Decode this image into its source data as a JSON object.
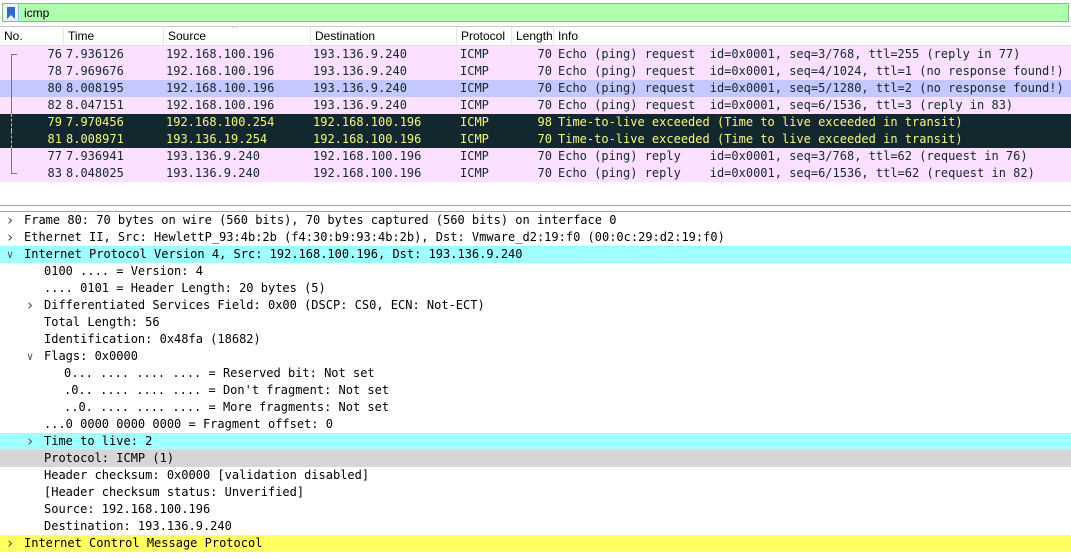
{
  "filter": {
    "text": "icmp"
  },
  "columns": [
    "No.",
    "Time",
    "Source",
    "Destination",
    "Protocol",
    "Length",
    "Info"
  ],
  "packets": [
    {
      "no": "76",
      "time": "7.936126",
      "src": "192.168.100.196",
      "dst": "193.136.9.240",
      "proto": "ICMP",
      "len": "70",
      "info": "Echo (ping) request  id=0x0001, seq=3/768, ttl=255 (reply in 77)",
      "style": "pink",
      "bracket": "first"
    },
    {
      "no": "78",
      "time": "7.969676",
      "src": "192.168.100.196",
      "dst": "193.136.9.240",
      "proto": "ICMP",
      "len": "70",
      "info": "Echo (ping) request  id=0x0001, seq=4/1024, ttl=1 (no response found!)",
      "style": "pink",
      "bracket": "mid"
    },
    {
      "no": "80",
      "time": "8.008195",
      "src": "192.168.100.196",
      "dst": "193.136.9.240",
      "proto": "ICMP",
      "len": "70",
      "info": "Echo (ping) request  id=0x0001, seq=5/1280, ttl=2 (no response found!)",
      "style": "selected",
      "bracket": "mid"
    },
    {
      "no": "82",
      "time": "8.047151",
      "src": "192.168.100.196",
      "dst": "193.136.9.240",
      "proto": "ICMP",
      "len": "70",
      "info": "Echo (ping) request  id=0x0001, seq=6/1536, ttl=3 (reply in 83)",
      "style": "pink",
      "bracket": "mid"
    },
    {
      "no": "79",
      "time": "7.970456",
      "src": "192.168.100.254",
      "dst": "192.168.100.196",
      "proto": "ICMP",
      "len": "98",
      "info": "Time-to-live exceeded (Time to live exceeded in transit)",
      "style": "dark",
      "bracket": "dashed"
    },
    {
      "no": "81",
      "time": "8.008971",
      "src": "193.136.19.254",
      "dst": "192.168.100.196",
      "proto": "ICMP",
      "len": "70",
      "info": "Time-to-live exceeded (Time to live exceeded in transit)",
      "style": "dark",
      "bracket": "dashed"
    },
    {
      "no": "77",
      "time": "7.936941",
      "src": "193.136.9.240",
      "dst": "192.168.100.196",
      "proto": "ICMP",
      "len": "70",
      "info": "Echo (ping) reply    id=0x0001, seq=3/768, ttl=62 (request in 76)",
      "style": "pink",
      "bracket": "mid"
    },
    {
      "no": "83",
      "time": "8.048025",
      "src": "193.136.9.240",
      "dst": "192.168.100.196",
      "proto": "ICMP",
      "len": "70",
      "info": "Echo (ping) reply    id=0x0001, seq=6/1536, ttl=62 (request in 82)",
      "style": "pink",
      "bracket": "last"
    }
  ],
  "details": [
    {
      "text": "Frame 80: 70 bytes on wire (560 bits), 70 bytes captured (560 bits) on interface 0",
      "level": 0,
      "arrow": "collapsed",
      "style": "first"
    },
    {
      "text": "Ethernet II, Src: HewlettP_93:4b:2b (f4:30:b9:93:4b:2b), Dst: Vmware_d2:19:f0 (00:0c:29:d2:19:f0)",
      "level": 0,
      "arrow": "collapsed",
      "style": "top"
    },
    {
      "text": "Internet Protocol Version 4, Src: 192.168.100.196, Dst: 193.136.9.240",
      "level": 0,
      "arrow": "expanded",
      "style": "cyan"
    },
    {
      "text": "0100 .... = Version: 4",
      "level": 1,
      "arrow": "none",
      "style": "top"
    },
    {
      "text": ".... 0101 = Header Length: 20 bytes (5)",
      "level": 1,
      "arrow": "none",
      "style": "top"
    },
    {
      "text": "Differentiated Services Field: 0x00 (DSCP: CS0, ECN: Not-ECT)",
      "level": 1,
      "arrow": "collapsed",
      "style": "top"
    },
    {
      "text": "Total Length: 56",
      "level": 1,
      "arrow": "none",
      "style": "top"
    },
    {
      "text": "Identification: 0x48fa (18682)",
      "level": 1,
      "arrow": "none",
      "style": "top"
    },
    {
      "text": "Flags: 0x0000",
      "level": 1,
      "arrow": "expanded",
      "style": "top"
    },
    {
      "text": "0... .... .... .... = Reserved bit: Not set",
      "level": 2,
      "arrow": "none",
      "style": "top"
    },
    {
      "text": ".0.. .... .... .... = Don't fragment: Not set",
      "level": 2,
      "arrow": "none",
      "style": "top"
    },
    {
      "text": "..0. .... .... .... = More fragments: Not set",
      "level": 2,
      "arrow": "none",
      "style": "top"
    },
    {
      "text": "...0 0000 0000 0000 = Fragment offset: 0",
      "level": 1,
      "arrow": "none",
      "style": "top"
    },
    {
      "text": "Time to live: 2",
      "level": 1,
      "arrow": "collapsed",
      "style": "cyan"
    },
    {
      "text": "Protocol: ICMP (1)",
      "level": 1,
      "arrow": "none",
      "style": "gray"
    },
    {
      "text": "Header checksum: 0x0000 [validation disabled]",
      "level": 1,
      "arrow": "none",
      "style": "top"
    },
    {
      "text": "[Header checksum status: Unverified]",
      "level": 1,
      "arrow": "none",
      "style": "top"
    },
    {
      "text": "Source: 192.168.100.196",
      "level": 1,
      "arrow": "none",
      "style": "top"
    },
    {
      "text": "Destination: 193.136.9.240",
      "level": 1,
      "arrow": "none",
      "style": "top"
    },
    {
      "text": "Internet Control Message Protocol",
      "level": 0,
      "arrow": "collapsed",
      "style": "yellow"
    }
  ],
  "colors": {
    "filter_valid": "#afffaf",
    "row_pink": "#fce0ff",
    "row_selected": "#c3c8ff",
    "row_dark_bg": "#12272e",
    "row_dark_fg": "#f7f780",
    "detail_highlight": "#a0ffff",
    "detail_yellow": "#ffff60"
  },
  "icons": {
    "bookmark": "bookmark-icon",
    "collapsed": "chevron-right-icon",
    "expanded": "chevron-down-icon",
    "sort": "sort-up-icon"
  }
}
